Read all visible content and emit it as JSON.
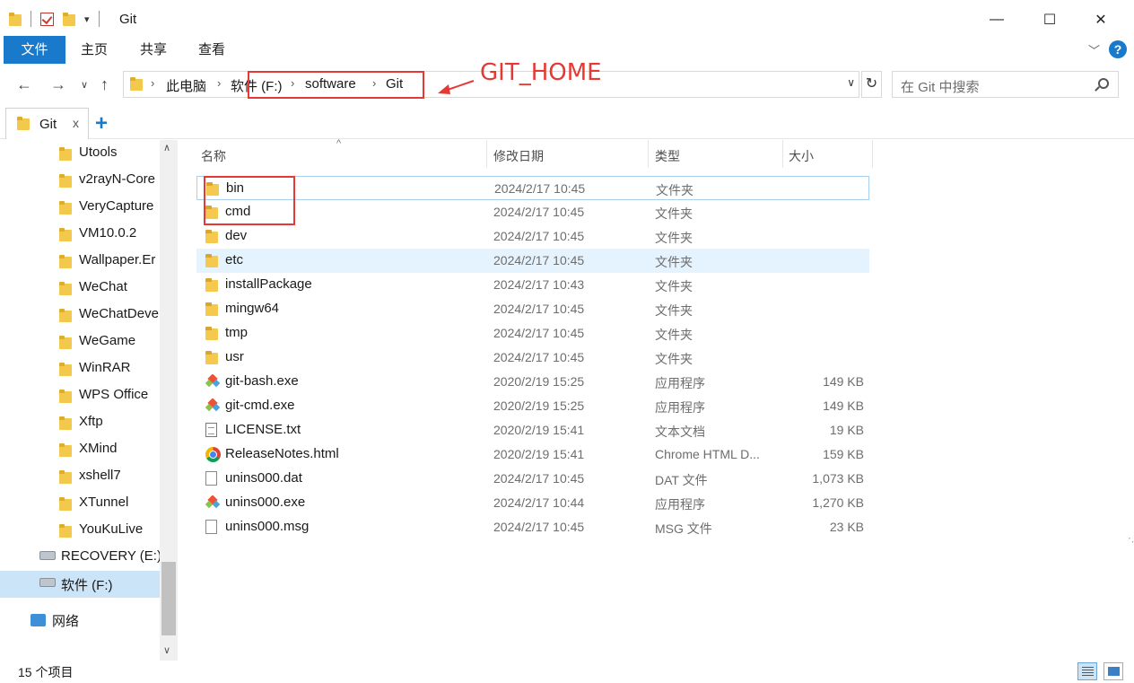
{
  "window": {
    "title": "Git",
    "minimize": "—",
    "maximize": "☐",
    "close": "✕"
  },
  "ribbon": {
    "tabs": [
      "文件",
      "主页",
      "共享",
      "查看"
    ],
    "collapse_chevron": "﹀",
    "help": "?"
  },
  "address": {
    "crumbs": [
      "此电脑",
      "软件 (F:)",
      "software",
      "Git"
    ],
    "chevron": "›",
    "search_placeholder": "在 Git 中搜索"
  },
  "annotation": {
    "label": "GIT_HOME",
    "color": "#e53935"
  },
  "tab": {
    "label": "Git",
    "close": "x",
    "add": "+"
  },
  "sidebar": {
    "items": [
      {
        "label": "Utools",
        "icon": "folder-icon"
      },
      {
        "label": "v2rayN-Core",
        "icon": "folder-icon"
      },
      {
        "label": "VeryCapture",
        "icon": "folder-icon"
      },
      {
        "label": "VM10.0.2",
        "icon": "folder-icon"
      },
      {
        "label": "Wallpaper.Er",
        "icon": "folder-icon"
      },
      {
        "label": "WeChat",
        "icon": "folder-icon"
      },
      {
        "label": "WeChatDeve",
        "icon": "folder-icon"
      },
      {
        "label": "WeGame",
        "icon": "folder-icon"
      },
      {
        "label": "WinRAR",
        "icon": "folder-icon"
      },
      {
        "label": "WPS Office",
        "icon": "folder-icon"
      },
      {
        "label": "Xftp",
        "icon": "folder-icon"
      },
      {
        "label": "XMind",
        "icon": "folder-icon"
      },
      {
        "label": "xshell7",
        "icon": "folder-icon"
      },
      {
        "label": "XTunnel",
        "icon": "folder-icon"
      },
      {
        "label": "YouKuLive",
        "icon": "folder-icon"
      },
      {
        "label": "RECOVERY (E:)",
        "icon": "drive-icon"
      },
      {
        "label": "软件 (F:)",
        "icon": "drive-icon",
        "selected": true
      },
      {
        "label": "网络",
        "icon": "network-icon"
      }
    ]
  },
  "columns": [
    "名称",
    "修改日期",
    "类型",
    "大小"
  ],
  "files": [
    {
      "name": "bin",
      "date": "2024/2/17 10:45",
      "type": "文件夹",
      "size": "",
      "icon": "folder"
    },
    {
      "name": "cmd",
      "date": "2024/2/17 10:45",
      "type": "文件夹",
      "size": "",
      "icon": "folder"
    },
    {
      "name": "dev",
      "date": "2024/2/17 10:45",
      "type": "文件夹",
      "size": "",
      "icon": "folder"
    },
    {
      "name": "etc",
      "date": "2024/2/17 10:45",
      "type": "文件夹",
      "size": "",
      "icon": "folder"
    },
    {
      "name": "installPackage",
      "date": "2024/2/17 10:43",
      "type": "文件夹",
      "size": "",
      "icon": "folder"
    },
    {
      "name": "mingw64",
      "date": "2024/2/17 10:45",
      "type": "文件夹",
      "size": "",
      "icon": "folder"
    },
    {
      "name": "tmp",
      "date": "2024/2/17 10:45",
      "type": "文件夹",
      "size": "",
      "icon": "folder"
    },
    {
      "name": "usr",
      "date": "2024/2/17 10:45",
      "type": "文件夹",
      "size": "",
      "icon": "folder"
    },
    {
      "name": "git-bash.exe",
      "date": "2020/2/19 15:25",
      "type": "应用程序",
      "size": "149 KB",
      "icon": "git"
    },
    {
      "name": "git-cmd.exe",
      "date": "2020/2/19 15:25",
      "type": "应用程序",
      "size": "149 KB",
      "icon": "git"
    },
    {
      "name": "LICENSE.txt",
      "date": "2020/2/19 15:41",
      "type": "文本文档",
      "size": "19 KB",
      "icon": "txt"
    },
    {
      "name": "ReleaseNotes.html",
      "date": "2020/2/19 15:41",
      "type": "Chrome HTML D...",
      "size": "159 KB",
      "icon": "chrome"
    },
    {
      "name": "unins000.dat",
      "date": "2024/2/17 10:45",
      "type": "DAT 文件",
      "size": "1,073 KB",
      "icon": "doc"
    },
    {
      "name": "unins000.exe",
      "date": "2024/2/17 10:44",
      "type": "应用程序",
      "size": "1,270 KB",
      "icon": "git"
    },
    {
      "name": "unins000.msg",
      "date": "2024/2/17 10:45",
      "type": "MSG 文件",
      "size": "23 KB",
      "icon": "doc"
    }
  ],
  "status": {
    "count": "15 个项目"
  },
  "colors": {
    "accent": "#1979ca",
    "selection": "#cce4f7",
    "hover": "#e5f3ff",
    "annotation": "#e53935"
  }
}
